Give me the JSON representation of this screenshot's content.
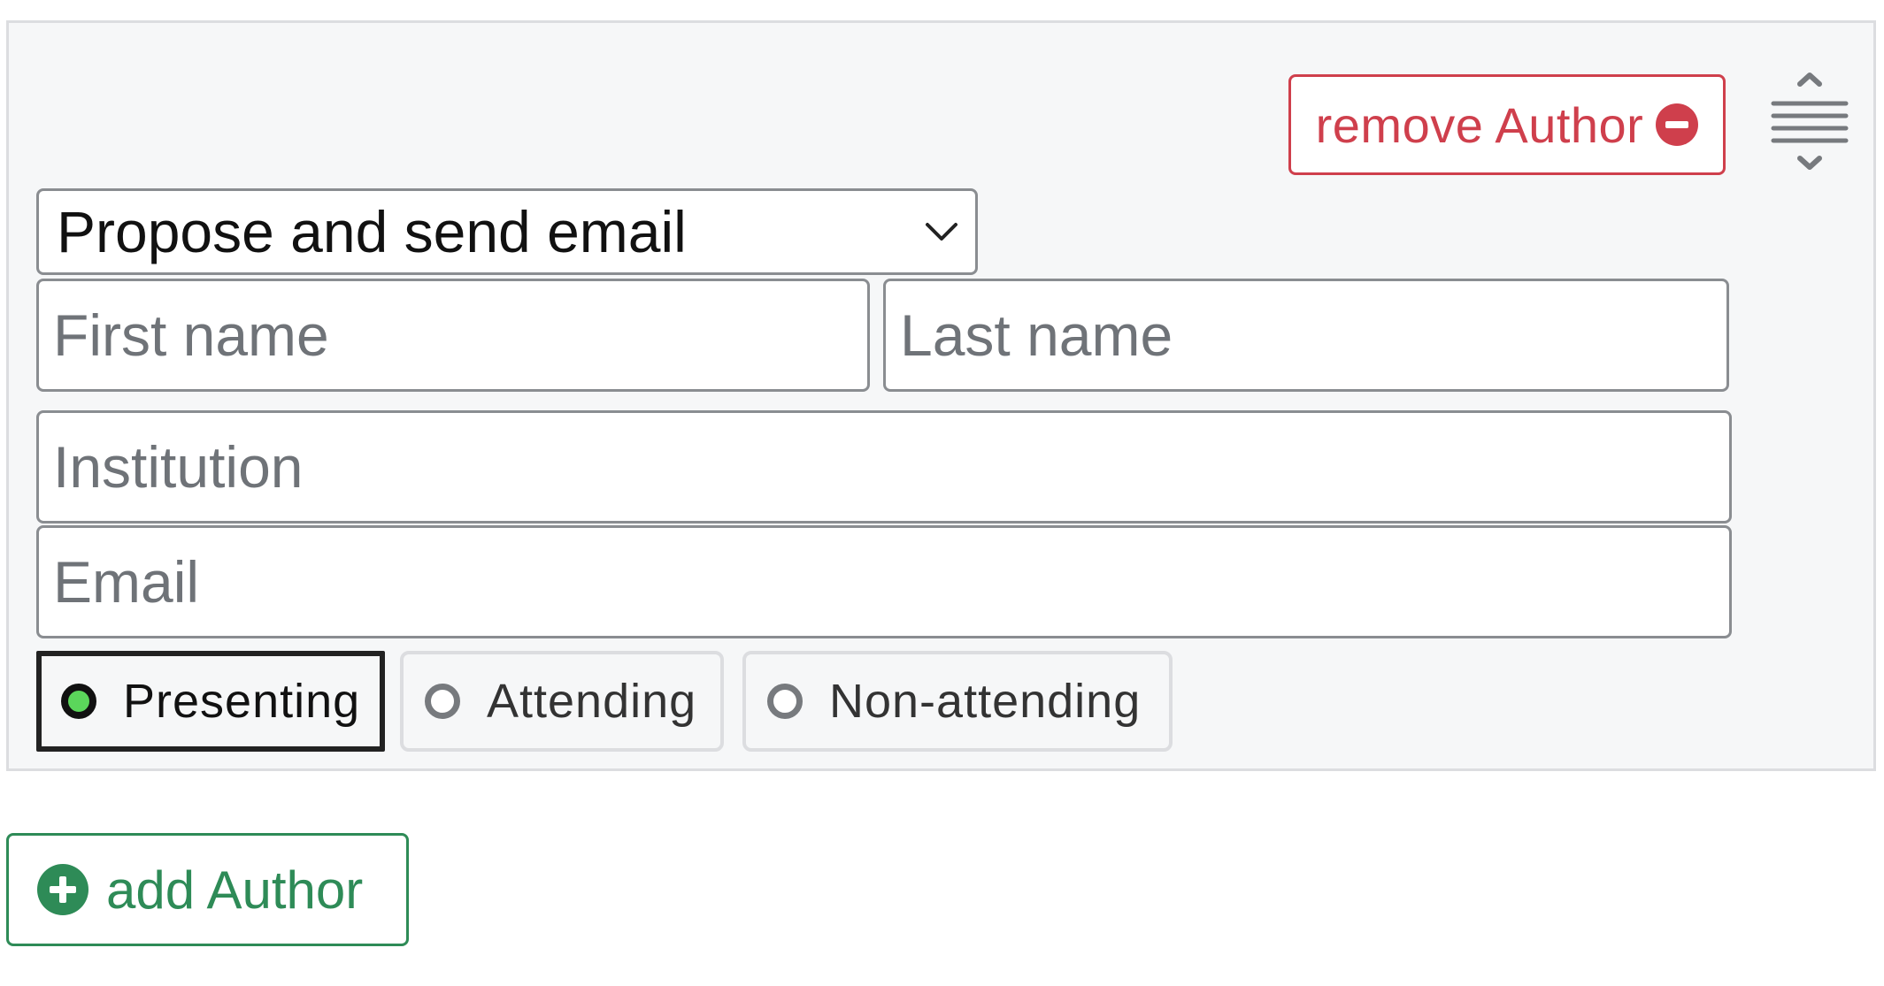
{
  "author": {
    "remove_label": "remove Author",
    "status_select": {
      "selected": "Propose and send email"
    },
    "fields": {
      "first_name_placeholder": "First name",
      "last_name_placeholder": "Last name",
      "institution_placeholder": "Institution",
      "email_placeholder": "Email"
    },
    "attendance": {
      "options": [
        "Presenting",
        "Attending",
        "Non-attending"
      ],
      "selected": "Presenting"
    }
  },
  "add_label": "add Author",
  "icons": {
    "remove": "minus-circle-icon",
    "add": "plus-circle-icon",
    "drag": "drag-handle-icon",
    "dropdown": "chevron-down-icon"
  },
  "colors": {
    "danger": "#cf3f4c",
    "success": "#2e8b57",
    "radio_selected": "#5bd65b",
    "panel_bg": "#f6f7f8"
  }
}
